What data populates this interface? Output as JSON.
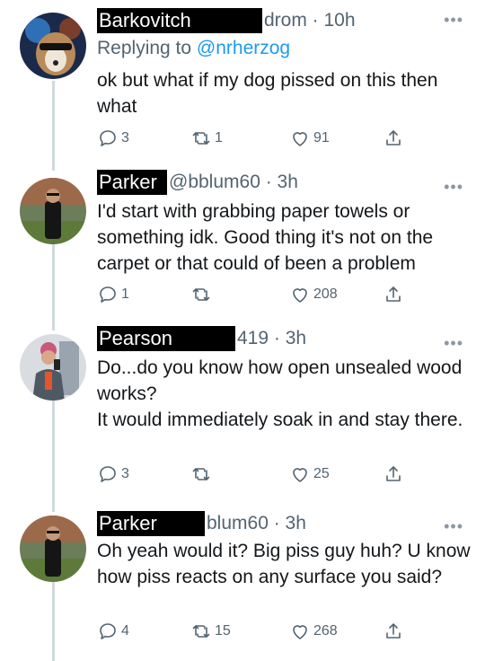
{
  "tweets": [
    {
      "name": "Barkovitch",
      "handle": "drom · 10h",
      "replying_prefix": "Replying to ",
      "replying_handle": "@nrherzog",
      "text": [
        "ok but what if my dog pissed on this then what"
      ],
      "replies": "3",
      "retweets": "1",
      "likes": "91"
    },
    {
      "name": "Parker",
      "handle": "@bblum60 · 3h",
      "text": [
        "I'd start with grabbing paper towels or something idk. Good thing it's not on the carpet or that could of been a problem"
      ],
      "replies": "1",
      "retweets": "",
      "likes": "208"
    },
    {
      "name": "Pearson",
      "handle": "419 · 3h",
      "text": [
        "Do...do you know how open unsealed wood works?",
        "It would immediately soak in and stay there."
      ],
      "replies": "3",
      "retweets": "",
      "likes": "25"
    },
    {
      "name": "Parker",
      "handle": "blum60 · 3h",
      "text": [
        "Oh yeah would it? Big piss guy huh? U know how piss reacts on any surface you said?"
      ],
      "replies": "4",
      "retweets": "15",
      "likes": "268"
    }
  ],
  "icons": {
    "more": "more-icon",
    "reply": "reply-icon",
    "retweet": "retweet-icon",
    "like": "like-icon",
    "share": "share-icon"
  },
  "colors": {
    "link": "#1d9bf0",
    "secondary": "#536471",
    "thread_line": "#cfd9de"
  }
}
